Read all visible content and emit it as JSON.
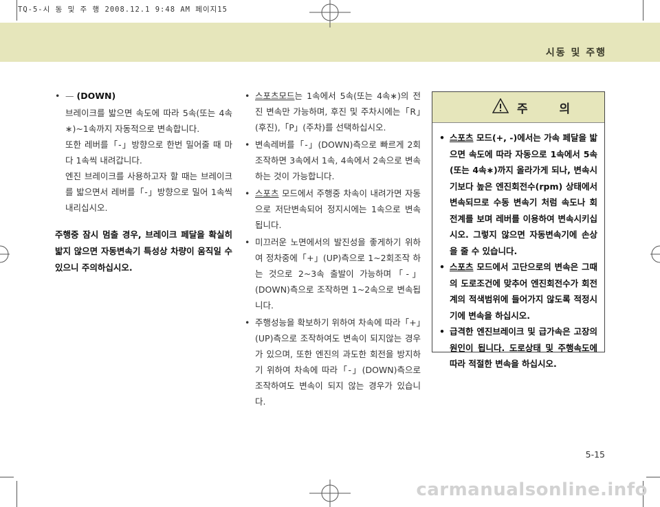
{
  "print_slug": "TQ-5-시 동 및 주 행  2008.12.1 9:48 AM 페이지15",
  "header": {
    "title": "시동 및 주행"
  },
  "left_column": {
    "heading": {
      "bullet": "•",
      "dash": "—",
      "text": "(DOWN)"
    },
    "paragraphs": [
      "브레이크를 밟으면 속도에 따라 5속(또는 4속 ∗)~1속까지 자동적으로 변속합니다.",
      "또한 레버를「-」방향으로 한번 밀어줄 때 마다 1속씩 내려갑니다.",
      "엔진 브레이크를 사용하고자 할 때는 브레이크를 밟으면서 레버를「-」방향으로 밀어 1속씩 내리십시오."
    ],
    "warning": "주행중 잠시 멈출 경우, 브레이크 페달을 확실히 밟지 않으면 자동변속기 특성상 차량이 움직일 수 있으니 주의하십시오."
  },
  "middle_column": {
    "items": [
      {
        "bullet": "•",
        "lead": "스포츠모드",
        "text": "는 1속에서 5속(또는 4속∗)의 전진 변속만 가능하며, 후진 및 주차시에는「R」(후진),「P」(주차)를 선택하십시오."
      },
      {
        "bullet": "•",
        "lead": "",
        "text": "변속레버를「-」(DOWN)측으로 빠르게 2회 조작하면 3속에서 1속, 4속에서 2속으로 변속하는 것이 가능합니다."
      },
      {
        "bullet": "•",
        "lead": "스포츠",
        "text": " 모드에서 주행중 차속이 내려가면 자동으로 저단변속되어 정지시에는 1속으로 변속됩니다."
      },
      {
        "bullet": "•",
        "lead": "",
        "text": "미끄러운 노면에서의 발진성을 좋게하기 위하여 정차중에「+」(UP)측으로 1~2회조작 하는 것으로 2~3속 출발이 가능하며「-」(DOWN)측으로 조작하면 1~2속으로 변속됩니다."
      },
      {
        "bullet": "•",
        "lead": "",
        "text": "주행성능을 확보하기 위하여 차속에 따라「+」(UP)측으로 조작하여도 변속이 되지않는 경우가 있으며, 또한 엔진의 과도한 회전을 방지하기 위하여 차속에 따라「-」(DOWN)측으로 조작하여도 변속이 되지 않는 경우가 있습니다."
      }
    ]
  },
  "caution": {
    "title": "주 의",
    "icon": "warning-triangle-icon",
    "items": [
      {
        "bullet": "•",
        "lead": "스포츠",
        "text": " 모드(+, -)에서는 가속 페달을 밟으면 속도에 따라 자동으로 1속에서 5속(또는 4속∗)까지 올라가게 되나, 변속시기보다 높은 엔진회전수(rpm) 상태에서 변속되므로 수동 변속기 처럼 속도나 회전계를 보며 레버를 이용하여 변속시키십시오. 그렇지 않으면 자동변속기에 손상을 줄 수 있습니다."
      },
      {
        "bullet": "•",
        "lead": "스포츠",
        "text": " 모드에서 고단으로의 변속은 그때의 도로조건에 맞추어 엔진회전수가 회전계의 적색범위에 들어가지 않도록 적정시기에 변속을 하십시오."
      },
      {
        "bullet": "•",
        "lead": "",
        "text": "급격한 엔진브레이크 및 급가속은 고장의 원인이 됩니다. 도로상태 및 주행속도에 따라 적절한 변속을 하십시오."
      }
    ]
  },
  "page_number": "5-15",
  "watermark": "carmanualsonline.info",
  "colors": {
    "band": "#e6e6bb",
    "text": "#333333",
    "watermark": "#d2d2d2"
  }
}
